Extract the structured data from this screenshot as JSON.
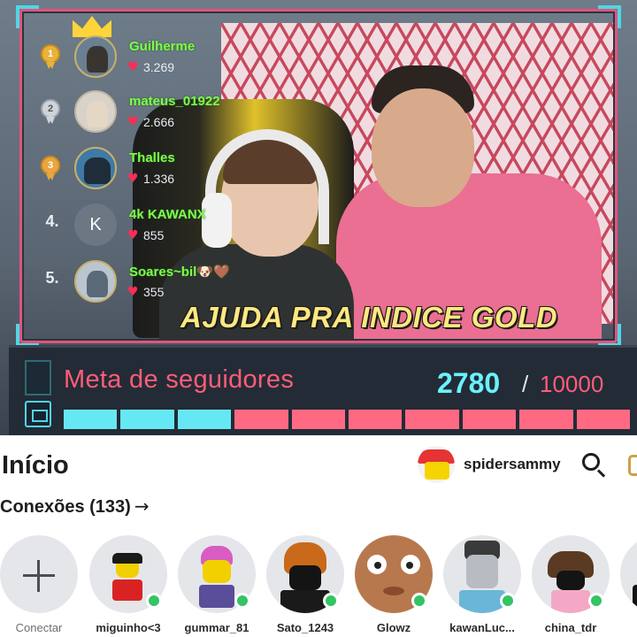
{
  "stream": {
    "caption": "AJUDA PRA INDICE GOLD",
    "leaderboard": [
      {
        "rank": "1",
        "name": "Guilherme",
        "score": "3.269"
      },
      {
        "rank": "2",
        "name": "mateus_01922",
        "score": "2.666"
      },
      {
        "rank": "3",
        "name": "Thalles",
        "score": "1.336"
      },
      {
        "rank": "4.",
        "name": "4k KAWANX",
        "score": "855",
        "initial": "K"
      },
      {
        "rank": "5.",
        "name": "Soares~bil🐶🤎",
        "score": "355"
      }
    ],
    "goal": {
      "label": "Meta de seguidores",
      "current": "2780",
      "separator": "/",
      "target": "10000",
      "progress": 0.278,
      "segments_total": 10,
      "segments_filled": 3
    },
    "heart_symbol": "♥",
    "colors": {
      "accent_cyan": "#66e8f4",
      "accent_pink": "#ff6a82",
      "name_green": "#7cff4d",
      "caption_yellow": "#ffe880"
    }
  },
  "app": {
    "title": "Início",
    "username": "spidersammy",
    "connections_label": "Conexões (133)",
    "connections_arrow": "→",
    "connect_label": "Conectar",
    "friends": [
      {
        "name": "miguinho<3",
        "online": true
      },
      {
        "name": "gummar_81",
        "online": true
      },
      {
        "name": "Sato_1243",
        "online": true
      },
      {
        "name": "Glowz",
        "online": true
      },
      {
        "name": "kawanLuc...",
        "online": true
      },
      {
        "name": "china_tdr",
        "online": true
      }
    ],
    "colors": {
      "online": "#33c463"
    }
  }
}
